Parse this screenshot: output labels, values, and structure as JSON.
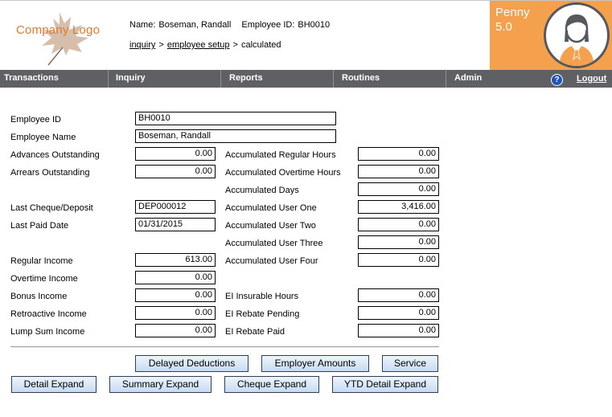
{
  "header": {
    "logo_text": "Company Logo",
    "name_label": "Name:",
    "name_value": "Boseman, Randall",
    "employee_id_label": "Employee ID:",
    "employee_id_value": "BH0010",
    "breadcrumb": {
      "items": [
        "inquiry",
        "employee setup",
        "calculated"
      ],
      "separator": ">"
    }
  },
  "profile": {
    "app_name": "Penny",
    "version": "5.0",
    "accent_color": "#f5a04d"
  },
  "nav": {
    "items": [
      "Transactions",
      "Inquiry",
      "Reports",
      "Routines",
      "Admin"
    ],
    "help_glyph": "?",
    "logout_label": "Logout",
    "bar_color": "#5f6063"
  },
  "form": {
    "employee_id": {
      "label": "Employee ID",
      "value": "BH0010"
    },
    "employee_name": {
      "label": "Employee Name",
      "value": "Boseman, Randall"
    },
    "advances_outstanding": {
      "label": "Advances Outstanding",
      "value": "0.00"
    },
    "arrears_outstanding": {
      "label": "Arrears Outstanding",
      "value": "0.00"
    },
    "last_cheque": {
      "label": "Last Cheque/Deposit",
      "value": "DEP000012"
    },
    "last_paid_date": {
      "label": "Last Paid Date",
      "value": "01/31/2015"
    },
    "regular_income": {
      "label": "Regular Income",
      "value": "613.00"
    },
    "overtime_income": {
      "label": "Overtime Income",
      "value": "0.00"
    },
    "bonus_income": {
      "label": "Bonus Income",
      "value": "0.00"
    },
    "retroactive_income": {
      "label": "Retroactive Income",
      "value": "0.00"
    },
    "lump_sum_income": {
      "label": "Lump Sum Income",
      "value": "0.00"
    },
    "acc_regular_hours": {
      "label": "Accumulated Regular Hours",
      "value": "0.00"
    },
    "acc_overtime_hours": {
      "label": "Accumulated Overtime Hours",
      "value": "0.00"
    },
    "acc_days": {
      "label": "Accumulated Days",
      "value": "0.00"
    },
    "acc_user_one": {
      "label": "Accumulated User One",
      "value": "3,416.00"
    },
    "acc_user_two": {
      "label": "Accumulated User Two",
      "value": "0.00"
    },
    "acc_user_three": {
      "label": "Accumulated User Three",
      "value": "0.00"
    },
    "acc_user_four": {
      "label": "Accumulated User Four",
      "value": "0.00"
    },
    "ei_insurable_hours": {
      "label": "EI Insurable Hours",
      "value": "0.00"
    },
    "ei_rebate_pending": {
      "label": "EI Rebate Pending",
      "value": "0.00"
    },
    "ei_rebate_paid": {
      "label": "EI Rebate Paid",
      "value": "0.00"
    }
  },
  "buttons": {
    "delayed_deductions": "Delayed Deductions",
    "employer_amounts": "Employer Amounts",
    "service": "Service",
    "detail_expand": "Detail Expand",
    "summary_expand": "Summary Expand",
    "cheque_expand": "Cheque Expand",
    "ytd_detail_expand": "YTD Detail Expand"
  }
}
